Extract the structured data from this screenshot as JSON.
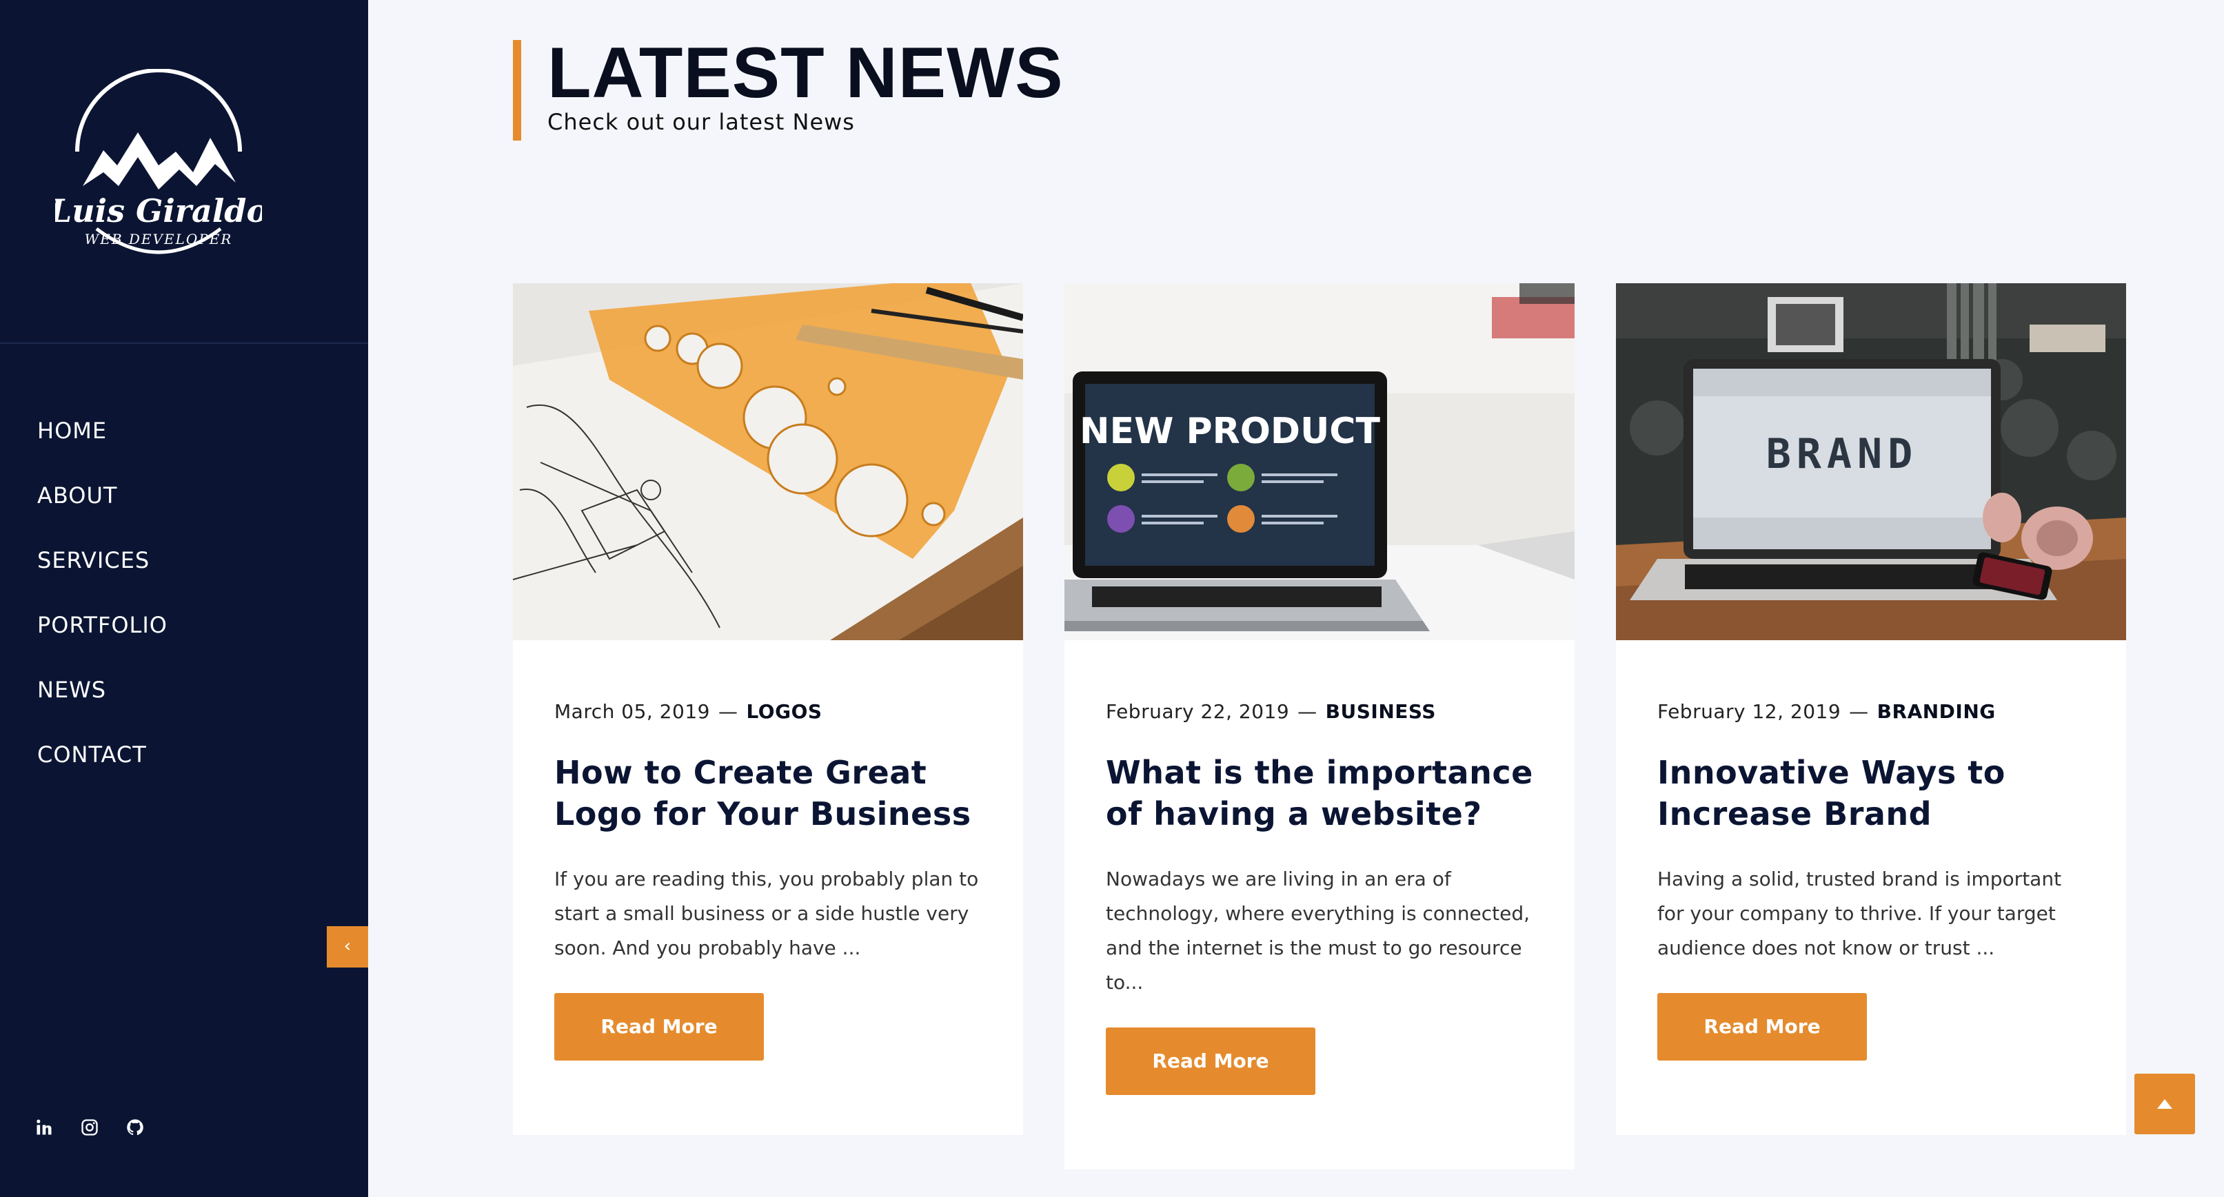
{
  "sidebar": {
    "logo": {
      "name": "Luis Giraldo",
      "tagline": "WEB DEVELOPER"
    },
    "nav": [
      {
        "label": "HOME"
      },
      {
        "label": "ABOUT"
      },
      {
        "label": "SERVICES"
      },
      {
        "label": "PORTFOLIO"
      },
      {
        "label": "NEWS"
      },
      {
        "label": "CONTACT"
      }
    ],
    "collapse_icon": "‹",
    "socials": [
      "linkedin-icon",
      "instagram-icon",
      "github-icon"
    ]
  },
  "header": {
    "title": "LATEST NEWS",
    "subtitle": "Check out our latest News"
  },
  "cards": [
    {
      "date": "March 05, 2019",
      "category": "LOGOS",
      "title": "How to Create Great Logo for Your Business",
      "excerpt": "If you are reading this, you probably plan to start a small business or a side hustle very soon. And you probably have ...",
      "button": "Read More"
    },
    {
      "date": "February 22, 2019",
      "category": "BUSINESS",
      "title": "What is the importance of having a website?",
      "excerpt": "Nowadays we are living in an era of technology, where everything is connected, and the internet is the must to go resource to...",
      "button": "Read More",
      "image_text": "NEW PRODUCT"
    },
    {
      "date": "February 12, 2019",
      "category": "BRANDING",
      "title": "Innovative Ways to Increase Brand",
      "excerpt": "Having a solid, trusted brand is important for your company to thrive. If your target audience does not know or trust ...",
      "button": "Read More",
      "image_text": "BRAND"
    }
  ],
  "colors": {
    "sidebar_bg": "#0b1533",
    "accent": "#e58b2d",
    "page_bg": "#f4f6fb"
  }
}
